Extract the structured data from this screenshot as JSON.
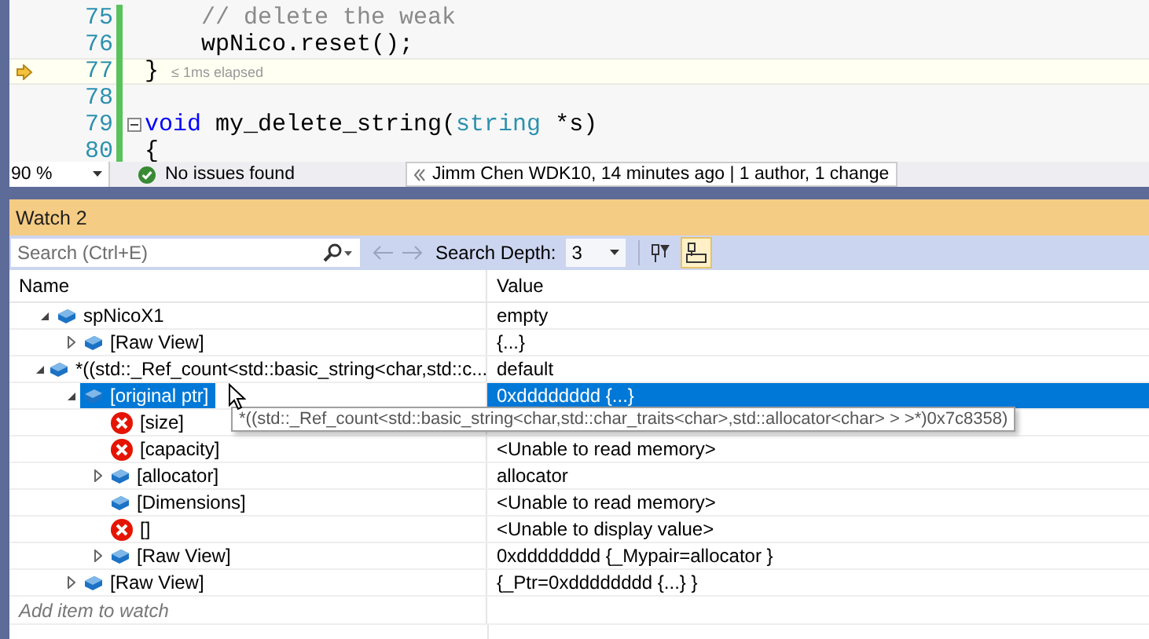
{
  "editor": {
    "lines": [
      {
        "number": "75",
        "tokens": [
          {
            "text": "    // delete the weak",
            "kind": "comment"
          }
        ]
      },
      {
        "number": "76",
        "tokens": [
          {
            "text": "    wpNico.reset();",
            "kind": "plain"
          }
        ]
      },
      {
        "number": "77",
        "tokens": [
          {
            "text": "}",
            "kind": "plain"
          }
        ],
        "hint": "≤ 1ms elapsed",
        "current": true
      },
      {
        "number": "78"
      },
      {
        "number": "79",
        "tokens": [
          {
            "text": "void",
            "kind": "keyword"
          },
          {
            "text": " my_delete_string(",
            "kind": "plain"
          },
          {
            "text": "string",
            "kind": "type"
          },
          {
            "text": " *s)",
            "kind": "plain"
          }
        ],
        "collapsible": true
      },
      {
        "number": "80",
        "tokens": [
          {
            "text": "{",
            "kind": "plain"
          }
        ]
      }
    ]
  },
  "status_bar": {
    "zoom": "90 %",
    "issues": "No issues found",
    "git": "Jimm Chen WDK10, 14 minutes ago | 1 author, 1 change"
  },
  "watch": {
    "title": "Watch 2",
    "search": {
      "placeholder": "Search (Ctrl+E)"
    },
    "search_depth": {
      "label": "Search Depth:",
      "value": "3"
    },
    "tools": [
      {
        "kind": "filter",
        "on": false
      },
      {
        "kind": "pin",
        "on": true
      }
    ],
    "columns": [
      "Name",
      "Value"
    ],
    "rows": [
      {
        "name": "spNicoX1",
        "value": "empty",
        "kind": "object",
        "expanded": true,
        "selected": false,
        "children": [
          {
            "name": "[Raw View]",
            "value": "{...}",
            "kind": "object",
            "expanded": false,
            "selected": false
          }
        ]
      },
      {
        "name": "*((std::_Ref_count<std::basic_string<char,std::c...",
        "value": "default",
        "kind": "object",
        "expanded": true,
        "selected": false,
        "children": [
          {
            "name": "[original ptr]",
            "value": "0xdddddddd {...}",
            "kind": "object",
            "expanded": true,
            "selected": true,
            "children": [
              {
                "name": "[size]",
                "kind": "error",
                "selected": false
              },
              {
                "name": "[capacity]",
                "value": "<Unable to read memory>",
                "kind": "error",
                "selected": false
              },
              {
                "name": "[allocator]",
                "value": "allocator",
                "kind": "object",
                "expanded": false,
                "selected": false
              },
              {
                "name": "[Dimensions]",
                "value": "<Unable to read memory>",
                "kind": "object",
                "selected": false
              },
              {
                "name": "[]",
                "value": "<Unable to display value>",
                "kind": "error",
                "selected": false
              },
              {
                "name": "[Raw View]",
                "value": "0xdddddddd {_Mypair=allocator }",
                "kind": "object",
                "expanded": false,
                "selected": false
              }
            ]
          },
          {
            "name": "[Raw View]",
            "value": "{_Ptr=0xdddddddd {...} }",
            "kind": "object",
            "expanded": false,
            "selected": false
          }
        ]
      }
    ],
    "tooltip": "*((std::_Ref_count<std::basic_string<char,std::char_traits<char>,std::allocator<char> > >*)0x7c8358)",
    "add_placeholder": "Add item to watch"
  }
}
